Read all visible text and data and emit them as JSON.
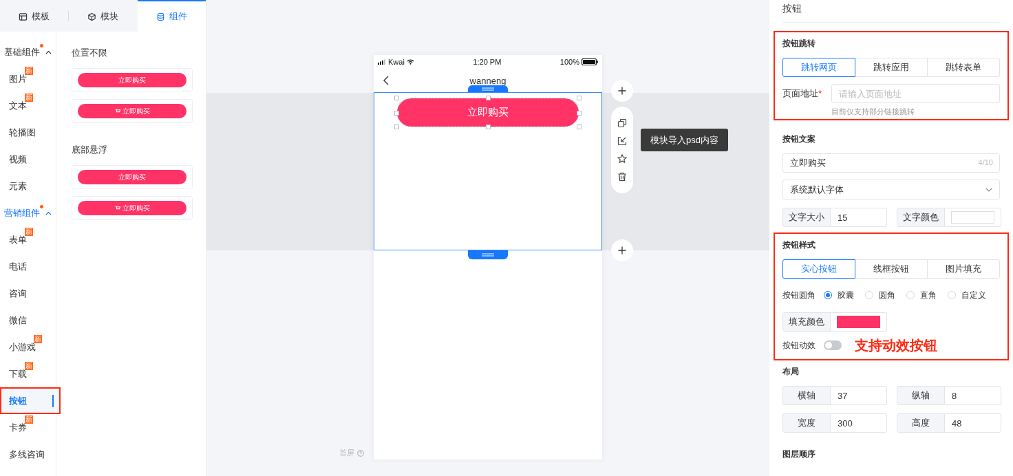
{
  "left_tabs": [
    {
      "label": "模板",
      "kind": "layout",
      "selected": false
    },
    {
      "label": "模块",
      "kind": "cube",
      "selected": false
    },
    {
      "label": "组件",
      "kind": "database",
      "selected": true
    }
  ],
  "categories": [
    {
      "label": "基础组件",
      "dot": true,
      "expanded": true,
      "active": false,
      "items": [
        {
          "label": "图片",
          "badge": "新",
          "selected": false,
          "annotated": false
        },
        {
          "label": "文本",
          "badge": "新",
          "selected": false,
          "annotated": false
        },
        {
          "label": "轮播图",
          "selected": false,
          "annotated": false
        },
        {
          "label": "视频",
          "selected": false,
          "annotated": false
        },
        {
          "label": "元素",
          "selected": false,
          "annotated": false
        }
      ]
    },
    {
      "label": "营销组件",
      "dot": true,
      "expanded": true,
      "active": true,
      "items": [
        {
          "label": "表单",
          "badge": "新",
          "selected": false,
          "annotated": false
        },
        {
          "label": "电话",
          "selected": false,
          "annotated": false
        },
        {
          "label": "咨询",
          "selected": false,
          "annotated": false
        },
        {
          "label": "微信",
          "selected": false,
          "annotated": false
        },
        {
          "label": "小游戏",
          "badge": "新",
          "selected": false,
          "annotated": false
        },
        {
          "label": "下载",
          "badge": "新",
          "selected": false,
          "annotated": false
        },
        {
          "label": "按钮",
          "selected": true,
          "annotated": true
        },
        {
          "label": "卡券",
          "badge": "新",
          "selected": false,
          "annotated": false
        },
        {
          "label": "多线咨询",
          "selected": false,
          "annotated": false
        }
      ]
    }
  ],
  "component_groups": [
    {
      "title": "位置不限",
      "items": [
        {
          "kind": "plain",
          "label": "立即购买"
        },
        {
          "kind": "cart",
          "label": "立即购买"
        }
      ]
    },
    {
      "title": "底部悬浮",
      "items": [
        {
          "kind": "plain",
          "label": "立即购买"
        },
        {
          "kind": "cart",
          "label": "立即购买"
        }
      ]
    }
  ],
  "phone": {
    "carrier": "Kwai",
    "time": "1:20 PM",
    "battery": "100%",
    "title": "wanneng",
    "module_selected": true,
    "button_label": "立即购买"
  },
  "module_tools": [
    {
      "kind": "copy"
    },
    {
      "kind": "import"
    },
    {
      "kind": "star"
    },
    {
      "kind": "delete"
    }
  ],
  "tooltip": "模块导入psd内容",
  "screen_label": "首屏",
  "properties": {
    "title": "按钮",
    "sections": [
      {
        "kind": "jump",
        "title": "按钮跳转",
        "annotated": true,
        "options": [
          {
            "label": "跳转网页",
            "selected": true
          },
          {
            "label": "跳转应用",
            "selected": false
          },
          {
            "label": "跳转表单",
            "selected": false
          }
        ],
        "url_label": "页面地址",
        "required_mark": "*",
        "url_placeholder": "请输入页面地址",
        "hint": "目前仅支持部分链接跳转"
      },
      {
        "kind": "text",
        "title": "按钮文案",
        "annotated": false,
        "value": "立即购买",
        "counter": "4/10",
        "font": "系统默认字体",
        "size_label": "文字大小",
        "size": "15",
        "color_label": "文字颜色"
      },
      {
        "kind": "style",
        "title": "按钮样式",
        "annotated": true,
        "options": [
          {
            "label": "实心按钮",
            "selected": true
          },
          {
            "label": "线框按钮",
            "selected": false
          },
          {
            "label": "图片填充",
            "selected": false
          }
        ],
        "corner_label": "按钮圆角",
        "corners": [
          {
            "label": "胶囊",
            "selected": true
          },
          {
            "label": "圆角",
            "selected": false
          },
          {
            "label": "直角",
            "selected": false
          },
          {
            "label": "自定义",
            "selected": false
          }
        ],
        "fill_label": "填充颜色",
        "animation_label": "按钮动效",
        "animation_on": false,
        "note": "支持动效按钮"
      },
      {
        "kind": "layout",
        "title": "布局",
        "annotated": false,
        "fields": [
          {
            "label": "横轴",
            "value": "37"
          },
          {
            "label": "纵轴",
            "value": "8"
          },
          {
            "label": "宽度",
            "value": "300"
          },
          {
            "label": "高度",
            "value": "48"
          }
        ]
      },
      {
        "kind": "order",
        "title": "图层顺序",
        "annotated": false
      }
    ]
  }
}
